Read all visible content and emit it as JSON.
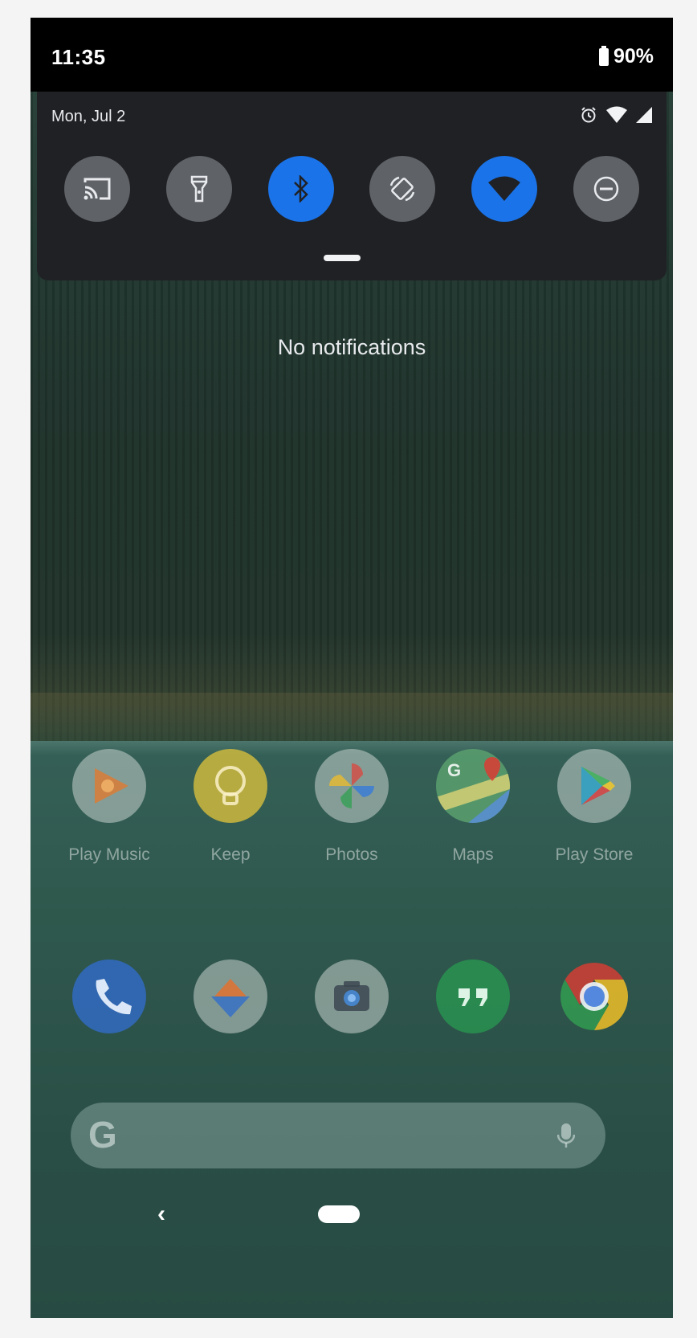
{
  "status_bar": {
    "time": "11:35",
    "battery_percent": "90%"
  },
  "quick_settings": {
    "date": "Mon, Jul 2",
    "status_icons": [
      "alarm-icon",
      "wifi-icon",
      "cellular-signal-icon"
    ],
    "tiles": [
      {
        "icon": "cast-icon",
        "active": false
      },
      {
        "icon": "flashlight-icon",
        "active": false
      },
      {
        "icon": "bluetooth-icon",
        "active": true
      },
      {
        "icon": "auto-rotate-icon",
        "active": false
      },
      {
        "icon": "wifi-icon",
        "active": true
      },
      {
        "icon": "do-not-disturb-icon",
        "active": false
      }
    ],
    "colors": {
      "panel": "#202124",
      "tile_off": "#5f6368",
      "tile_on": "#1a73e8"
    }
  },
  "notifications": {
    "empty_text": "No notifications"
  },
  "home": {
    "apps_row": [
      {
        "label": "Play Music",
        "icon": "play-music-icon"
      },
      {
        "label": "Keep",
        "icon": "keep-icon"
      },
      {
        "label": "Photos",
        "icon": "photos-icon"
      },
      {
        "label": "Maps",
        "icon": "maps-icon"
      },
      {
        "label": "Play Store",
        "icon": "play-store-icon"
      }
    ],
    "dock": [
      {
        "icon": "phone-icon"
      },
      {
        "icon": "files-icon"
      },
      {
        "icon": "camera-icon"
      },
      {
        "icon": "hangouts-icon"
      },
      {
        "icon": "chrome-icon"
      }
    ],
    "search_bar": {
      "logo": "G",
      "mic_icon": "mic-icon"
    }
  },
  "navigation": {
    "back_glyph": "‹",
    "home_icon": "home-pill-icon"
  }
}
